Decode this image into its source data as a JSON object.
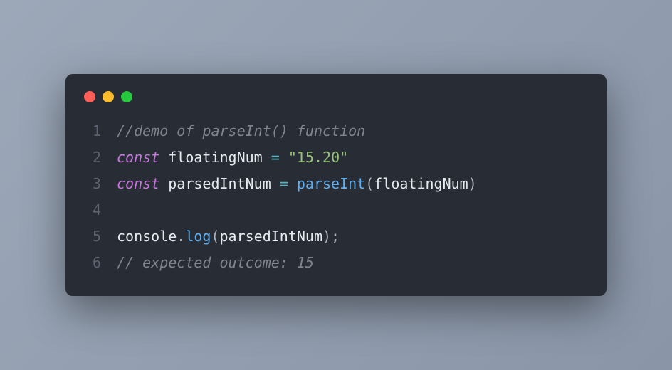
{
  "window": {
    "traffic_lights": [
      "close",
      "minimize",
      "maximize"
    ]
  },
  "code": {
    "lines": [
      {
        "num": "1",
        "tokens": [
          {
            "cls": "tok-comment",
            "text": "//demo of parseInt() function"
          }
        ]
      },
      {
        "num": "2",
        "tokens": [
          {
            "cls": "tok-keyword",
            "text": "const"
          },
          {
            "cls": "tok-default",
            "text": " floatingNum "
          },
          {
            "cls": "tok-operator",
            "text": "="
          },
          {
            "cls": "tok-default",
            "text": " "
          },
          {
            "cls": "tok-string",
            "text": "\"15.20\""
          }
        ]
      },
      {
        "num": "3",
        "tokens": [
          {
            "cls": "tok-keyword",
            "text": "const"
          },
          {
            "cls": "tok-default",
            "text": " parsedIntNum "
          },
          {
            "cls": "tok-operator",
            "text": "="
          },
          {
            "cls": "tok-default",
            "text": " "
          },
          {
            "cls": "tok-func",
            "text": "parseInt"
          },
          {
            "cls": "tok-punct",
            "text": "("
          },
          {
            "cls": "tok-default",
            "text": "floatingNum"
          },
          {
            "cls": "tok-punct",
            "text": ")"
          }
        ]
      },
      {
        "num": "4",
        "tokens": [
          {
            "cls": "tok-default",
            "text": ""
          }
        ]
      },
      {
        "num": "5",
        "tokens": [
          {
            "cls": "tok-default",
            "text": "console"
          },
          {
            "cls": "tok-punct",
            "text": "."
          },
          {
            "cls": "tok-func",
            "text": "log"
          },
          {
            "cls": "tok-punct",
            "text": "("
          },
          {
            "cls": "tok-default",
            "text": "parsedIntNum"
          },
          {
            "cls": "tok-punct",
            "text": ");"
          }
        ]
      },
      {
        "num": "6",
        "tokens": [
          {
            "cls": "tok-comment",
            "text": "// expected outcome: 15"
          }
        ]
      }
    ]
  }
}
